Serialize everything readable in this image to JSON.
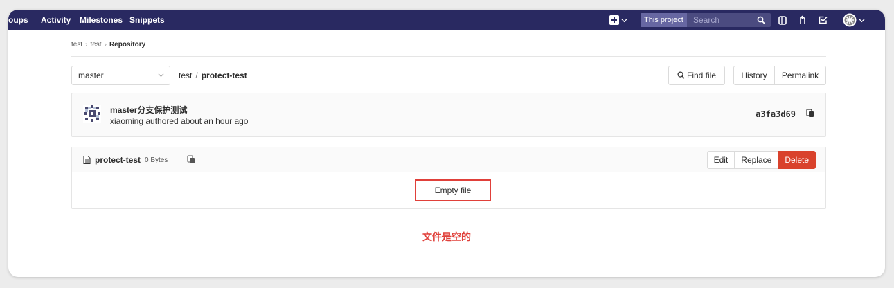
{
  "navbar": {
    "links": [
      "oups",
      "Activity",
      "Milestones",
      "Snippets"
    ],
    "search_scope": "This project",
    "search_placeholder": "Search",
    "icons": [
      "plus-square-icon",
      "search-icon",
      "issues-icon",
      "merge-request-icon",
      "todo-icon",
      "avatar-icon"
    ],
    "background": "#292961"
  },
  "breadcrumb": {
    "items": [
      "test",
      "test",
      "Repository"
    ]
  },
  "repo_header": {
    "branch": "master",
    "path_parent": "test",
    "path_sep": "/",
    "path_file": "protect-test",
    "find_file_label": "Find file",
    "history_label": "History",
    "permalink_label": "Permalink"
  },
  "commit": {
    "title": "master分支保护测试",
    "meta": "xiaoming authored about an hour ago",
    "sha": "a3fa3d69"
  },
  "file": {
    "name": "protect-test",
    "size": "0 Bytes",
    "actions": {
      "edit": "Edit",
      "replace": "Replace",
      "delete": "Delete"
    },
    "content": "Empty file"
  },
  "annotation": "文件是空的",
  "colors": {
    "accent_red": "#e0403a",
    "delete_button": "#d9422c"
  }
}
